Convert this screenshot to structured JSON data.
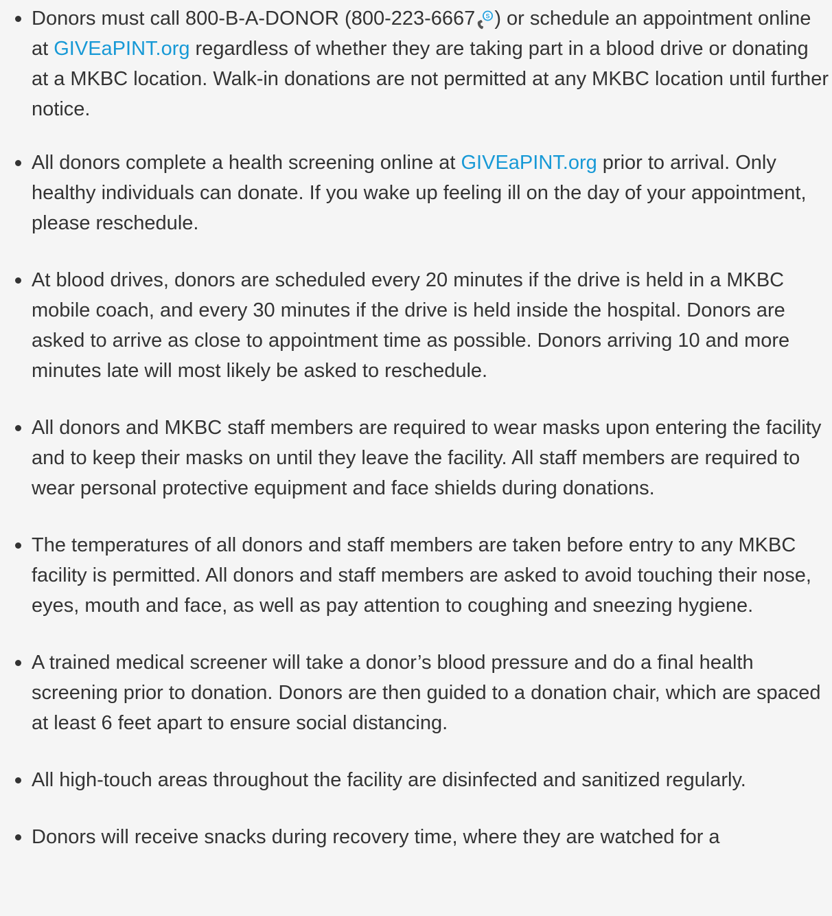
{
  "items": [
    {
      "text_before": "Donors must call 800-B-A-DONOR (800-223-6667",
      "text_after": ") or schedule an appointment online at ",
      "link": "GIVEaPINT.org",
      "text_end": " regardless of whether they are taking part in a blood drive or donating at a MKBC location. Walk-in donations are not permitted at any MKBC location until further notice.",
      "icon": "skype-call-icon"
    },
    {
      "text_before": "All donors complete a health screening online at ",
      "link": "GIVEaPINT.org",
      "text_after": " prior to arrival. Only healthy individuals can donate. If you wake up feeling ill on the day of your appointment, please reschedule."
    },
    {
      "text": "At blood drives, donors are scheduled every 20 minutes if the drive is held in a MKBC mobile coach, and every 30 minutes if the drive is held inside the hospital. Donors are asked to arrive as close to appointment time as possible. Donors arriving 10 and more minutes late will most likely be asked to reschedule."
    },
    {
      "text": "All donors and MKBC staff members are required to wear masks upon entering the facility and to keep their masks on until they leave the facility. All staff members are required to wear personal protective equipment and face shields during donations."
    },
    {
      "text": "The temperatures of all donors and staff members are taken before entry to any MKBC facility is permitted. All donors and staff members are asked to avoid touching their nose, eyes, mouth and face, as well as pay attention to coughing and sneezing hygiene."
    },
    {
      "text": "A trained medical screener will take a donor’s blood pressure and do a final health screening prior to donation. Donors are then guided to a donation chair, which are spaced at least 6 feet apart to ensure social distancing."
    },
    {
      "text": "All high-touch areas throughout the facility are disinfected and sanitized regularly."
    },
    {
      "text": "Donors will receive snacks during recovery time, where they are watched for a"
    }
  ],
  "colors": {
    "background": "#f5f5f5",
    "text": "#333333",
    "link": "#1799d6",
    "icon": "#2aa3df"
  }
}
